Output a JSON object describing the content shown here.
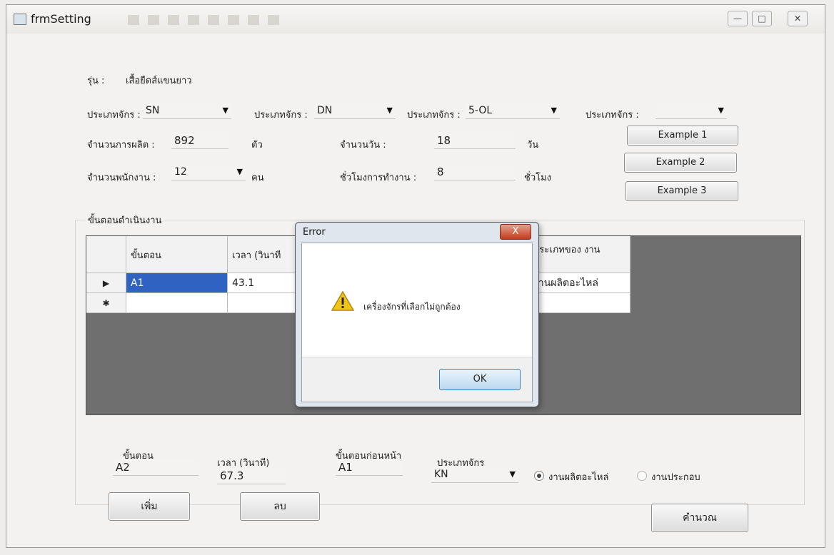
{
  "window": {
    "title": "frmSetting",
    "controls": {
      "minimize": "—",
      "maximize": "□",
      "close": "✕"
    }
  },
  "form": {
    "model_label": "รุ่น :",
    "model_value": "เสื้อยืดส์แขนยาว",
    "machine_types": [
      {
        "label": "ประเภทจักร :",
        "value": "SN"
      },
      {
        "label": "ประเภทจักร :",
        "value": "DN"
      },
      {
        "label": "ประเภทจักร :",
        "value": "5-OL"
      },
      {
        "label": "ประเภทจักร :",
        "value": ""
      }
    ],
    "production_qty_label": "จำนวนการผลิต :",
    "production_qty_value": "892",
    "production_qty_unit": "ตัว",
    "days_label": "จำนวนวัน :",
    "days_value": "18",
    "days_unit": "วัน",
    "workers_label": "จำนวนพนักงาน :",
    "workers_value": "12",
    "workers_unit": "คน",
    "hours_label": "ชั่วโมงการทำงาน :",
    "hours_value": "8",
    "hours_unit": "ชั่วโมง",
    "example_buttons": [
      "Example 1",
      "Example 2",
      "Example 3"
    ]
  },
  "steps_group": {
    "title": "ขั้นตอนดำเนินงาน",
    "columns": [
      "ขั้นตอน",
      "เวลา (วินาที",
      "ประเภทของ งาน"
    ],
    "rows": [
      {
        "marker": "▶",
        "step": "A1",
        "time": "43.1",
        "type": "งานผลิตอะไหล่"
      },
      {
        "marker": "✱",
        "step": "",
        "time": "",
        "type": ""
      }
    ]
  },
  "entry": {
    "step_label": "ขั้นตอน",
    "step_value": "A2",
    "time_label": "เวลา (วินาที)",
    "time_value": "67.3",
    "prev_step_label": "ขั้นตอนก่อนหน้า",
    "prev_step_value": "A1",
    "machine_label": "ประเภทจักร",
    "machine_value": "KN",
    "radio_options": [
      {
        "label": "งานผลิตอะไหล่",
        "checked": true
      },
      {
        "label": "งานประกอบ",
        "checked": false
      }
    ]
  },
  "buttons": {
    "add": "เพิ่ม",
    "delete": "ลบ",
    "calculate": "คำนวณ"
  },
  "dialog": {
    "title": "Error",
    "close": "X",
    "message": "เครื่องจักรที่เลือกไม่ถูกต้อง",
    "ok": "OK",
    "icon": "warning-icon"
  }
}
